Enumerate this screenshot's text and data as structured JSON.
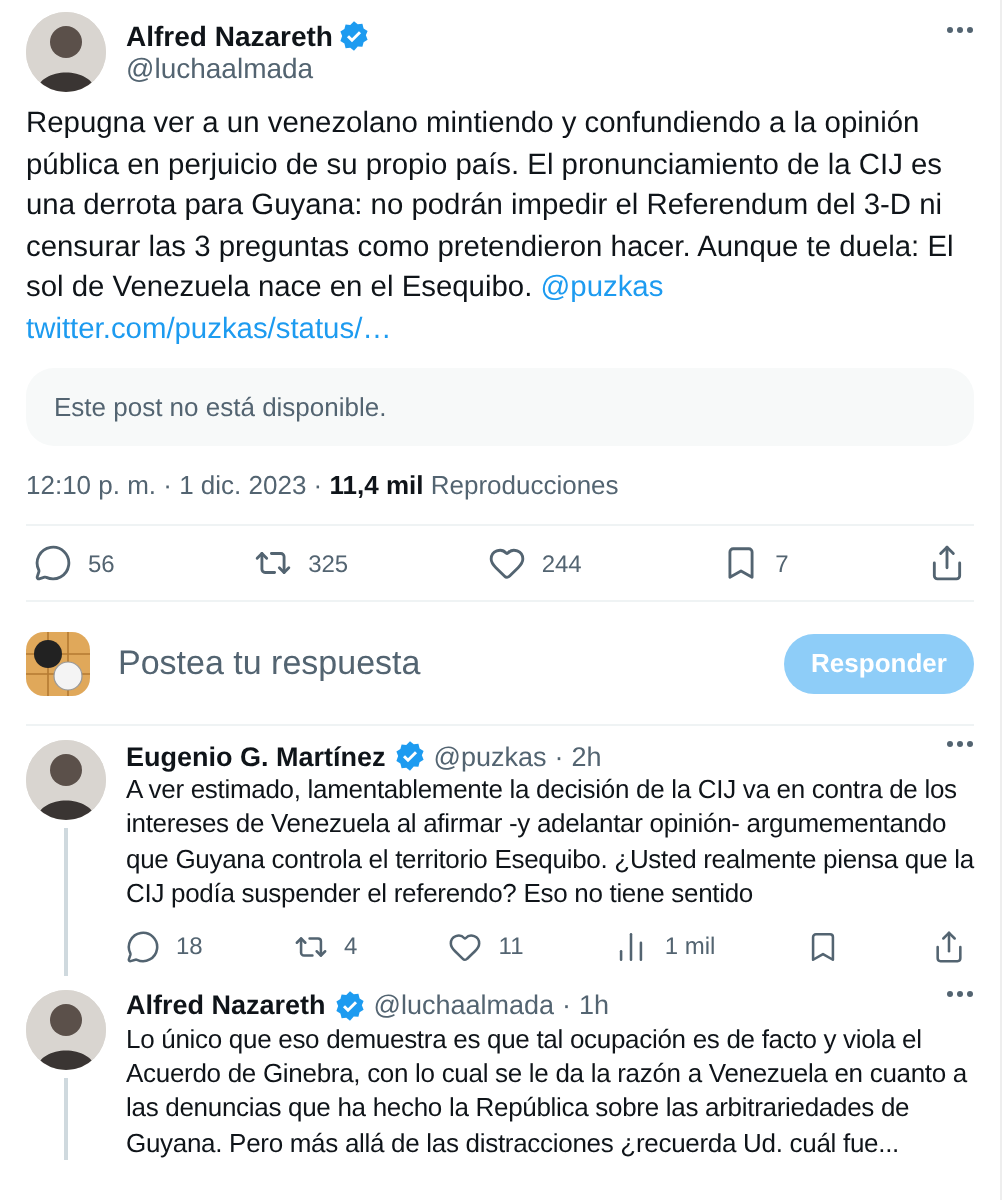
{
  "post": {
    "author": {
      "name": "Alfred Nazareth",
      "handle": "@luchaalmada",
      "verified": true
    },
    "text": "Repugna ver a un venezolano mintiendo y confundiendo a la opinión pública en perjuicio de su propio país. El pronunciamiento de la CIJ es una derrota para Guyana: no podrán impedir el Referendum del 3-D ni censurar las 3 preguntas como pretendieron hacer. Aunque te duela: El sol de Venezuela nace en el Esequibo.",
    "mention": "@puzkas",
    "link": "twitter.com/puzkas/status/…",
    "quoted": "Este post no está disponible.",
    "meta": "12:10 p. m. · 1 dic. 2023 · **11,4 mil** Reproducciones",
    "actions": [
      {
        "kind": "reply",
        "count": "56"
      },
      {
        "kind": "repost",
        "count": "325"
      },
      {
        "kind": "like",
        "count": "244"
      },
      {
        "kind": "bookmark",
        "count": "7"
      },
      {
        "kind": "share"
      }
    ]
  },
  "composer": {
    "placeholder": "Postea tu respuesta",
    "button": "Responder",
    "disabled": true
  },
  "replies": [
    {
      "name": "Eugenio G. Martínez",
      "handle": "@puzkas",
      "dot": "·",
      "time": "2h",
      "verified": true,
      "text": "A ver estimado, lamentablemente la decisión de la CIJ va en contra de los intereses de Venezuela al afirmar -y adelantar opinión- argumementando que Guyana controla el territorio Esequibo. ¿Usted realmente piensa que la CIJ podía suspender el referendo? Eso no tiene sentido",
      "actions": [
        {
          "kind": "reply",
          "count": "18"
        },
        {
          "kind": "repost",
          "count": "4"
        },
        {
          "kind": "like",
          "count": "11"
        },
        {
          "kind": "views",
          "count": "1 mil"
        },
        {
          "kind": "bookmark"
        },
        {
          "kind": "share"
        }
      ]
    },
    {
      "name": "Alfred Nazareth",
      "handle": "@luchaalmada",
      "dot": "·",
      "time": "1h",
      "verified": true,
      "text": "Lo único que eso demuestra es que tal ocupación es de facto y viola el Acuerdo de Ginebra, con lo cual se le da la razón a Venezuela en cuanto a las denuncias que ha hecho la República sobre las arbitrariedades de Guyana. Pero más allá de las distracciones ¿recuerda Ud. cuál fue..."
    }
  ]
}
